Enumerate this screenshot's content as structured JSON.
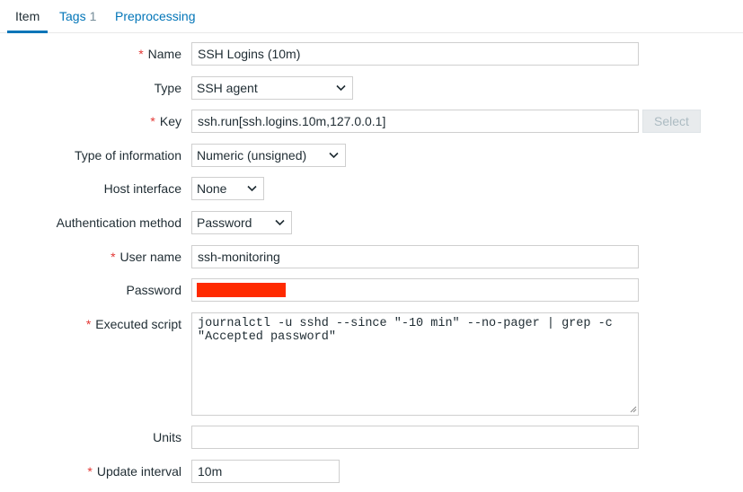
{
  "tabs": {
    "item": "Item",
    "tags": "Tags",
    "tags_count": "1",
    "preprocessing": "Preprocessing"
  },
  "form": {
    "required_marker": "*",
    "name": {
      "label": "Name",
      "value": "SSH Logins (10m)"
    },
    "type": {
      "label": "Type",
      "value": "SSH agent"
    },
    "key": {
      "label": "Key",
      "value": "ssh.run[ssh.logins.10m,127.0.0.1]",
      "select_button": "Select"
    },
    "type_of_information": {
      "label": "Type of information",
      "value": "Numeric (unsigned)"
    },
    "host_interface": {
      "label": "Host interface",
      "value": "None"
    },
    "authentication_method": {
      "label": "Authentication method",
      "value": "Password"
    },
    "user_name": {
      "label": "User name",
      "value": "ssh-monitoring"
    },
    "password": {
      "label": "Password"
    },
    "executed_script": {
      "label": "Executed script",
      "value": "journalctl -u sshd --since \"-10 min\" --no-pager | grep -c \"Accepted password\""
    },
    "units": {
      "label": "Units",
      "value": ""
    },
    "update_interval": {
      "label": "Update interval",
      "value": "10m"
    }
  },
  "colors": {
    "accent": "#0275b8",
    "required": "#e33734",
    "redaction": "#ff2a00"
  },
  "icons": {
    "dropdown": "chevron-down-icon",
    "resize": "resize-handle-icon"
  }
}
